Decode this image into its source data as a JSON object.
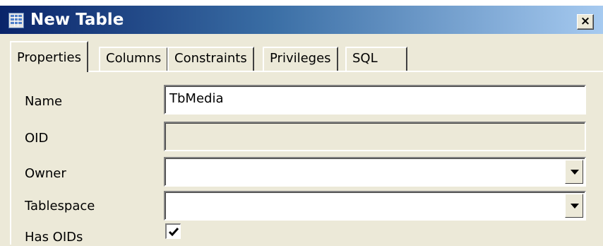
{
  "window": {
    "title": "New Table",
    "close_label": "×"
  },
  "tabs": [
    {
      "label": "Properties",
      "active": true
    },
    {
      "label": "Columns",
      "active": false
    },
    {
      "label": "Constraints",
      "active": false
    },
    {
      "label": "Privileges",
      "active": false
    },
    {
      "label": "SQL",
      "active": false
    }
  ],
  "form": {
    "name": {
      "label": "Name",
      "value": "TbMedia"
    },
    "oid": {
      "label": "OID",
      "value": ""
    },
    "owner": {
      "label": "Owner",
      "value": ""
    },
    "tablespace": {
      "label": "Tablespace",
      "value": ""
    },
    "has_oids": {
      "label": "Has OIDs",
      "checked": true
    }
  },
  "icons": {
    "title_icon": "table-icon",
    "dropdown_icon": "chevron-down-icon",
    "check_icon": "check-icon"
  },
  "colors": {
    "titlebar_start": "#0a246a",
    "titlebar_end": "#a6caf0",
    "window_bg": "#ece9d8"
  }
}
